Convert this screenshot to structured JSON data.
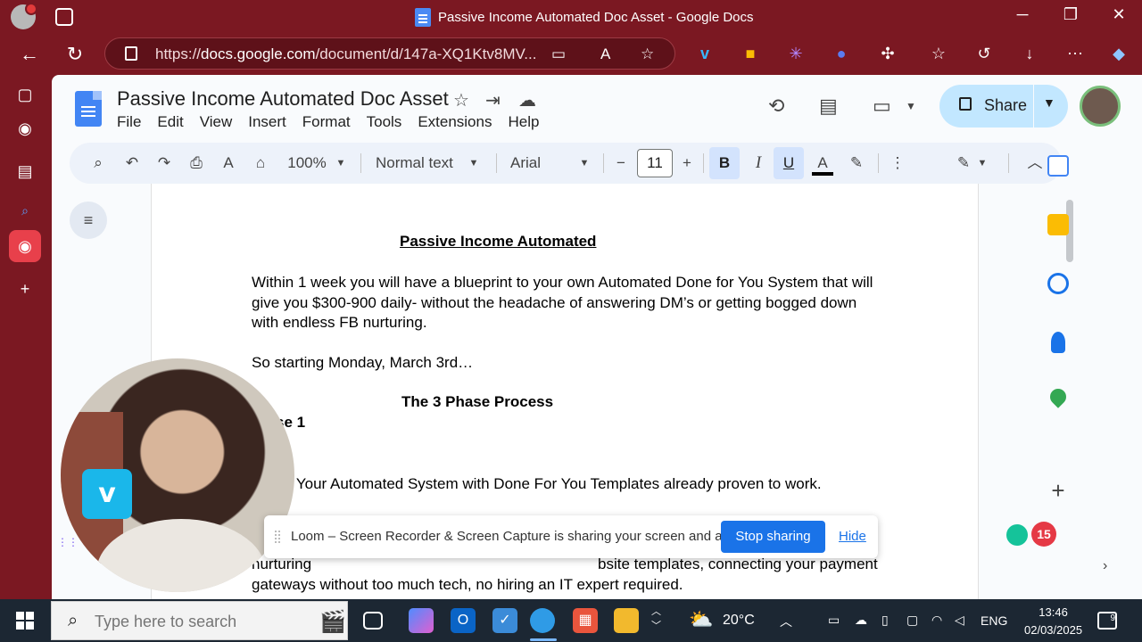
{
  "browser": {
    "window_title": "Passive Income Automated Doc Asset - Google Docs",
    "url_domain": "docs.google.com",
    "url_scheme": "https://",
    "url_path": "/document/d/147a-XQ1Ktv8MV...",
    "controls": {
      "minimize": "─",
      "restore": "❐",
      "close": "✕"
    },
    "accent_color": "#7b1822"
  },
  "docs": {
    "title": "Passive Income Automated Doc Asset",
    "menu": [
      "File",
      "Edit",
      "View",
      "Insert",
      "Format",
      "Tools",
      "Extensions",
      "Help"
    ],
    "share_label": "Share",
    "toolbar": {
      "zoom": "100%",
      "style": "Normal text",
      "font": "Arial",
      "font_size": "11",
      "bold_label": "B",
      "italic_label": "I",
      "underline_label": "U",
      "text_color_label": "A",
      "minus": "−",
      "plus": "+"
    }
  },
  "document": {
    "heading": "Passive Income Automated",
    "para1_line1": "Within 1 week you will have a blueprint to your own Automated Done for You System that will",
    "para1_line2": "give you $300-900 daily- without the headache of answering DM’s or getting bogged down",
    "para1_line3": "with endless FB nurturing.",
    "para2": "So starting Monday, March 3rd…",
    "section_heading": "The 3 Phase Process",
    "phase_label": "se 1",
    "para3": "p Your Automated System with Done For You Templates already proven to work.",
    "para4_line1_start": "nurturing",
    "para4_line1_end": "bsite templates, connecting your payment",
    "para4_line2": "gateways without too much tech, no hiring an IT expert required."
  },
  "loom": {
    "message": "Loom – Screen Recorder & Screen Capture is sharing your screen and audio.",
    "stop_label": "Stop sharing",
    "hide_label": "Hide"
  },
  "badge_count": "15",
  "taskbar": {
    "search_placeholder": "Type here to search",
    "temperature": "20°C",
    "language": "ENG",
    "time": "13:46",
    "date": "02/03/2025",
    "notifications": "9"
  }
}
